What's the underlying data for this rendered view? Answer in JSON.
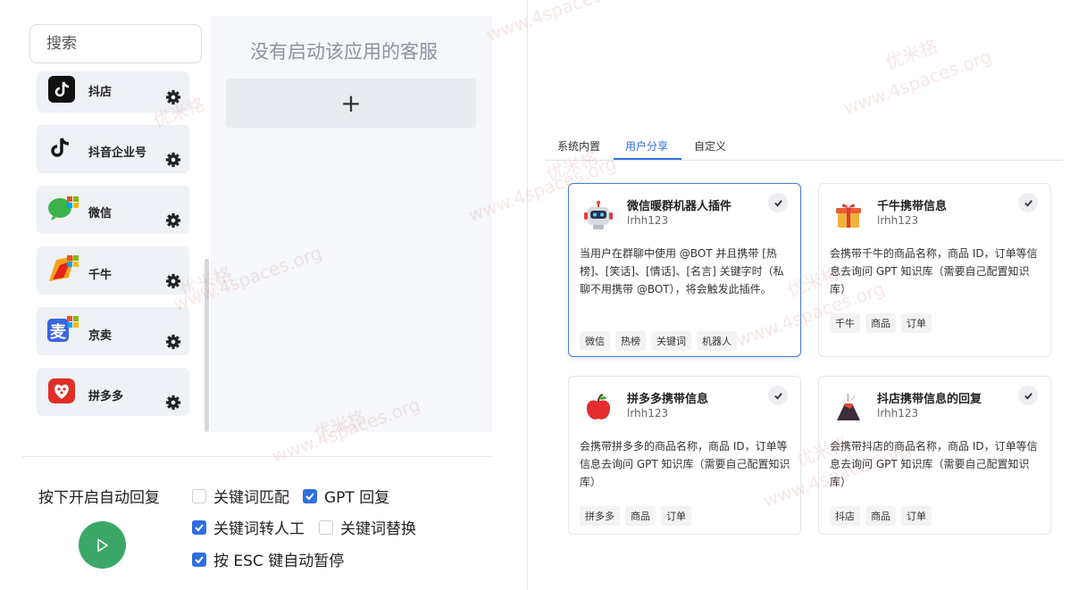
{
  "search": {
    "placeholder": "搜索"
  },
  "apps": [
    {
      "name": "抖店",
      "icon": "douyin-shop-icon"
    },
    {
      "name": "抖音企业号",
      "icon": "douyin-icon"
    },
    {
      "name": "微信",
      "icon": "wechat-icon"
    },
    {
      "name": "千牛",
      "icon": "qianniu-icon"
    },
    {
      "name": "京卖",
      "icon": "jingmai-icon"
    },
    {
      "name": "拼多多",
      "icon": "pinduoduo-icon"
    }
  ],
  "service_panel": {
    "empty_text": "没有启动该应用的客服",
    "add_label": "+"
  },
  "auto_reply": {
    "start_label": "按下开启自动回复",
    "options": [
      {
        "label": "关键词匹配",
        "checked": false
      },
      {
        "label": "GPT 回复",
        "checked": true
      },
      {
        "label": "关键词转人工",
        "checked": true
      },
      {
        "label": "关键词替换",
        "checked": false
      },
      {
        "label": "按 ESC 键自动暂停",
        "checked": true
      }
    ]
  },
  "tabs": [
    {
      "label": "系统内置",
      "active": false
    },
    {
      "label": "用户分享",
      "active": true
    },
    {
      "label": "自定义",
      "active": false
    }
  ],
  "plugins": [
    {
      "title": "微信暖群机器人插件",
      "author": "lrhh123",
      "icon": "robot-icon",
      "selected": true,
      "desc": "当用户在群聊中使用 @BOT 并且携带 [热榜]、[笑话]、[情话]、[名言] 关键字时（私聊不用携带 @BOT），将会触发此插件。",
      "tags": [
        "微信",
        "热榜",
        "关键词",
        "机器人"
      ]
    },
    {
      "title": "千牛携带信息",
      "author": "lrhh123",
      "icon": "gift-icon",
      "selected": false,
      "desc": "会携带千牛的商品名称，商品 ID，订单等信息去询问 GPT 知识库（需要自己配置知识库）",
      "tags": [
        "千牛",
        "商品",
        "订单"
      ]
    },
    {
      "title": "拼多多携带信息",
      "author": "lrhh123",
      "icon": "apple-icon",
      "selected": false,
      "desc": "会携带拼多多的商品名称，商品 ID，订单等信息去询问 GPT 知识库（需要自己配置知识库）",
      "tags": [
        "拼多多",
        "商品",
        "订单"
      ]
    },
    {
      "title": "抖店携带信息的回复",
      "author": "lrhh123",
      "icon": "volcano-icon",
      "selected": false,
      "desc": "会携带抖店的商品名称，商品 ID，订单等信息去询问 GPT 知识库（需要自己配置知识库）",
      "tags": [
        "抖店",
        "商品",
        "订单"
      ]
    }
  ],
  "watermark": {
    "text": "www.4spaces.org",
    "cn": "优米格"
  },
  "colors": {
    "accent": "#2f6fde",
    "play": "#3aa766",
    "panel": "#f5f7fa"
  }
}
